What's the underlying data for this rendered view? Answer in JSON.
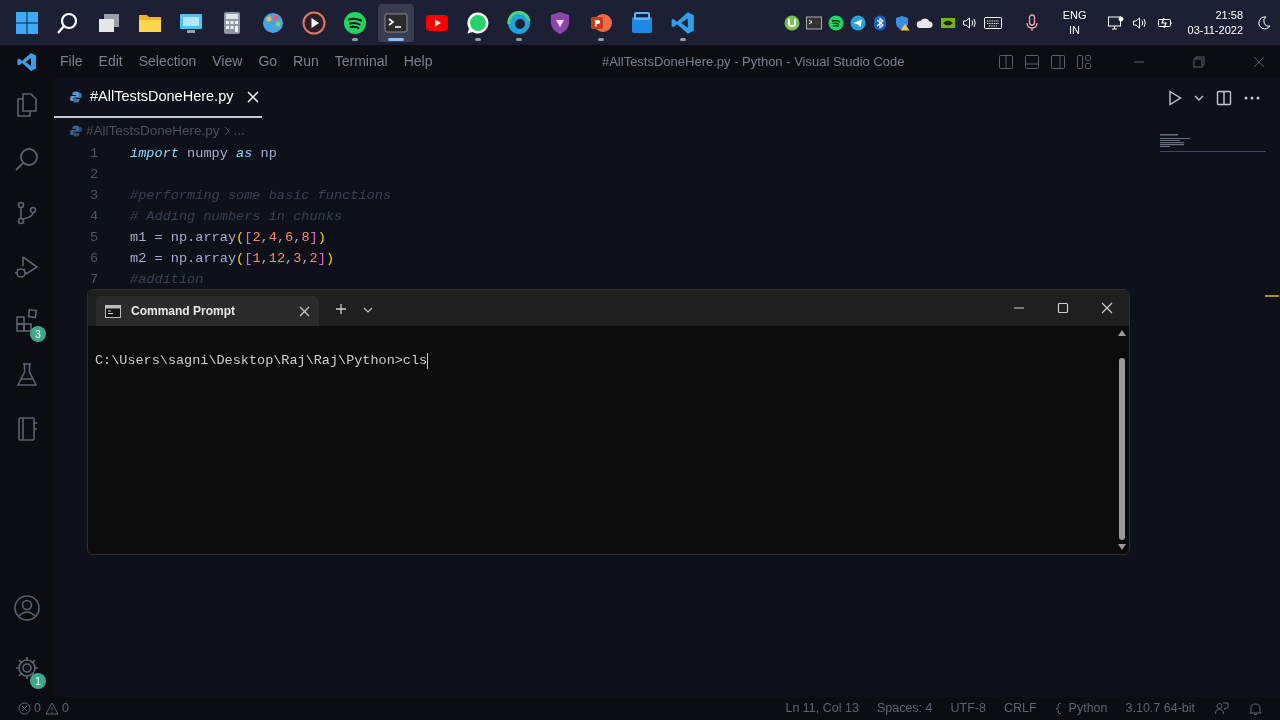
{
  "taskbar": {
    "apps": [
      {
        "kind": "windows",
        "running": false,
        "selected": false
      },
      {
        "kind": "search",
        "running": false,
        "selected": false
      },
      {
        "kind": "taskview",
        "running": false,
        "selected": false
      },
      {
        "kind": "folder",
        "running": false,
        "selected": false
      },
      {
        "kind": "monitor",
        "running": false,
        "selected": false
      },
      {
        "kind": "calculator",
        "running": false,
        "selected": false
      },
      {
        "kind": "palette",
        "running": false,
        "selected": false
      },
      {
        "kind": "player",
        "running": false,
        "selected": false
      },
      {
        "kind": "music",
        "running": true,
        "selected": false
      },
      {
        "kind": "terminal",
        "running": true,
        "selected": true
      },
      {
        "kind": "video",
        "running": false,
        "selected": false
      },
      {
        "kind": "chat",
        "running": true,
        "selected": false
      },
      {
        "kind": "browser",
        "running": true,
        "selected": false
      },
      {
        "kind": "lion",
        "running": false,
        "selected": false
      },
      {
        "kind": "slides",
        "running": true,
        "selected": false
      },
      {
        "kind": "store",
        "running": false,
        "selected": false
      },
      {
        "kind": "editor",
        "running": true,
        "selected": false
      }
    ],
    "language": {
      "line_1": "ENG",
      "line_2": "IN"
    },
    "clock": {
      "time": "21:58",
      "date": "03-11-2022"
    }
  },
  "titlebar": {
    "menu": [
      "File",
      "Edit",
      "Selection",
      "View",
      "Go",
      "Run",
      "Terminal",
      "Help"
    ],
    "title": "#AllTestsDoneHere.py - Python - Visual Studio Code"
  },
  "activity_bar": {
    "items": [
      {
        "kind": "files",
        "selected": false
      },
      {
        "kind": "search",
        "selected": false
      },
      {
        "kind": "branch",
        "selected": false
      },
      {
        "kind": "debug",
        "selected": false
      },
      {
        "kind": "extensions",
        "selected": false,
        "badge": "3"
      },
      {
        "kind": "flask",
        "selected": false
      },
      {
        "kind": "book",
        "selected": false
      }
    ],
    "bottom": [
      {
        "kind": "account",
        "selected": false
      },
      {
        "kind": "gear",
        "selected": false,
        "badge": "1"
      }
    ]
  },
  "editor": {
    "tabs": [
      {
        "label": "#AllTestsDoneHere.py",
        "selected": true
      }
    ],
    "breadcrumb": [
      "#AllTestsDoneHere.py",
      "..."
    ],
    "lines": [
      {
        "number": "1",
        "tokens": [
          {
            "kind": "keyword",
            "text": "import"
          },
          {
            "kind": "plain",
            "text": " numpy "
          },
          {
            "kind": "keyword",
            "text": "as"
          },
          {
            "kind": "plain",
            "text": " np"
          }
        ]
      },
      {
        "number": "2"
      },
      {
        "number": "3",
        "tokens": [
          {
            "kind": "comment",
            "text": "#performing some basic functions"
          }
        ]
      },
      {
        "number": "4",
        "tokens": [
          {
            "kind": "comment",
            "text": "# Adding numbers in chunks"
          }
        ]
      },
      {
        "number": "5",
        "tokens": [
          {
            "kind": "plain",
            "text": "m1 = np.array"
          },
          {
            "kind": "paren",
            "text": "("
          },
          {
            "kind": "bracket",
            "text": "["
          },
          {
            "kind": "number",
            "text": "2"
          },
          {
            "kind": "plain",
            "text": ","
          },
          {
            "kind": "number",
            "text": "4"
          },
          {
            "kind": "plain",
            "text": ","
          },
          {
            "kind": "number",
            "text": "6"
          },
          {
            "kind": "plain",
            "text": ","
          },
          {
            "kind": "number",
            "text": "8"
          },
          {
            "kind": "bracket",
            "text": "]"
          },
          {
            "kind": "paren",
            "text": ")"
          }
        ]
      },
      {
        "number": "6",
        "tokens": [
          {
            "kind": "plain",
            "text": "m2 = np.array"
          },
          {
            "kind": "paren",
            "text": "("
          },
          {
            "kind": "bracket",
            "text": "["
          },
          {
            "kind": "number",
            "text": "1"
          },
          {
            "kind": "plain",
            "text": ","
          },
          {
            "kind": "number",
            "text": "12"
          },
          {
            "kind": "plain",
            "text": ","
          },
          {
            "kind": "number",
            "text": "3"
          },
          {
            "kind": "plain",
            "text": ","
          },
          {
            "kind": "number",
            "text": "2"
          },
          {
            "kind": "bracket",
            "text": "]"
          },
          {
            "kind": "paren",
            "text": ")"
          }
        ]
      },
      {
        "number": "7",
        "tokens": [
          {
            "kind": "comment",
            "text": "#addition"
          }
        ]
      }
    ]
  },
  "terminal": {
    "tabs": [
      {
        "label": "Command Prompt",
        "selected": true
      }
    ],
    "lines": [
      "C:\\Users\\sagni\\Desktop\\Raj\\Raj\\Python>cls"
    ]
  },
  "status_bar": {
    "errors": "0",
    "warnings": "0",
    "items": [
      "Ln 11, Col 13",
      "Spaces: 4",
      "UTF-8",
      "CRLF"
    ],
    "language": "Python",
    "interpreter": "3.10.7 64-bit"
  }
}
